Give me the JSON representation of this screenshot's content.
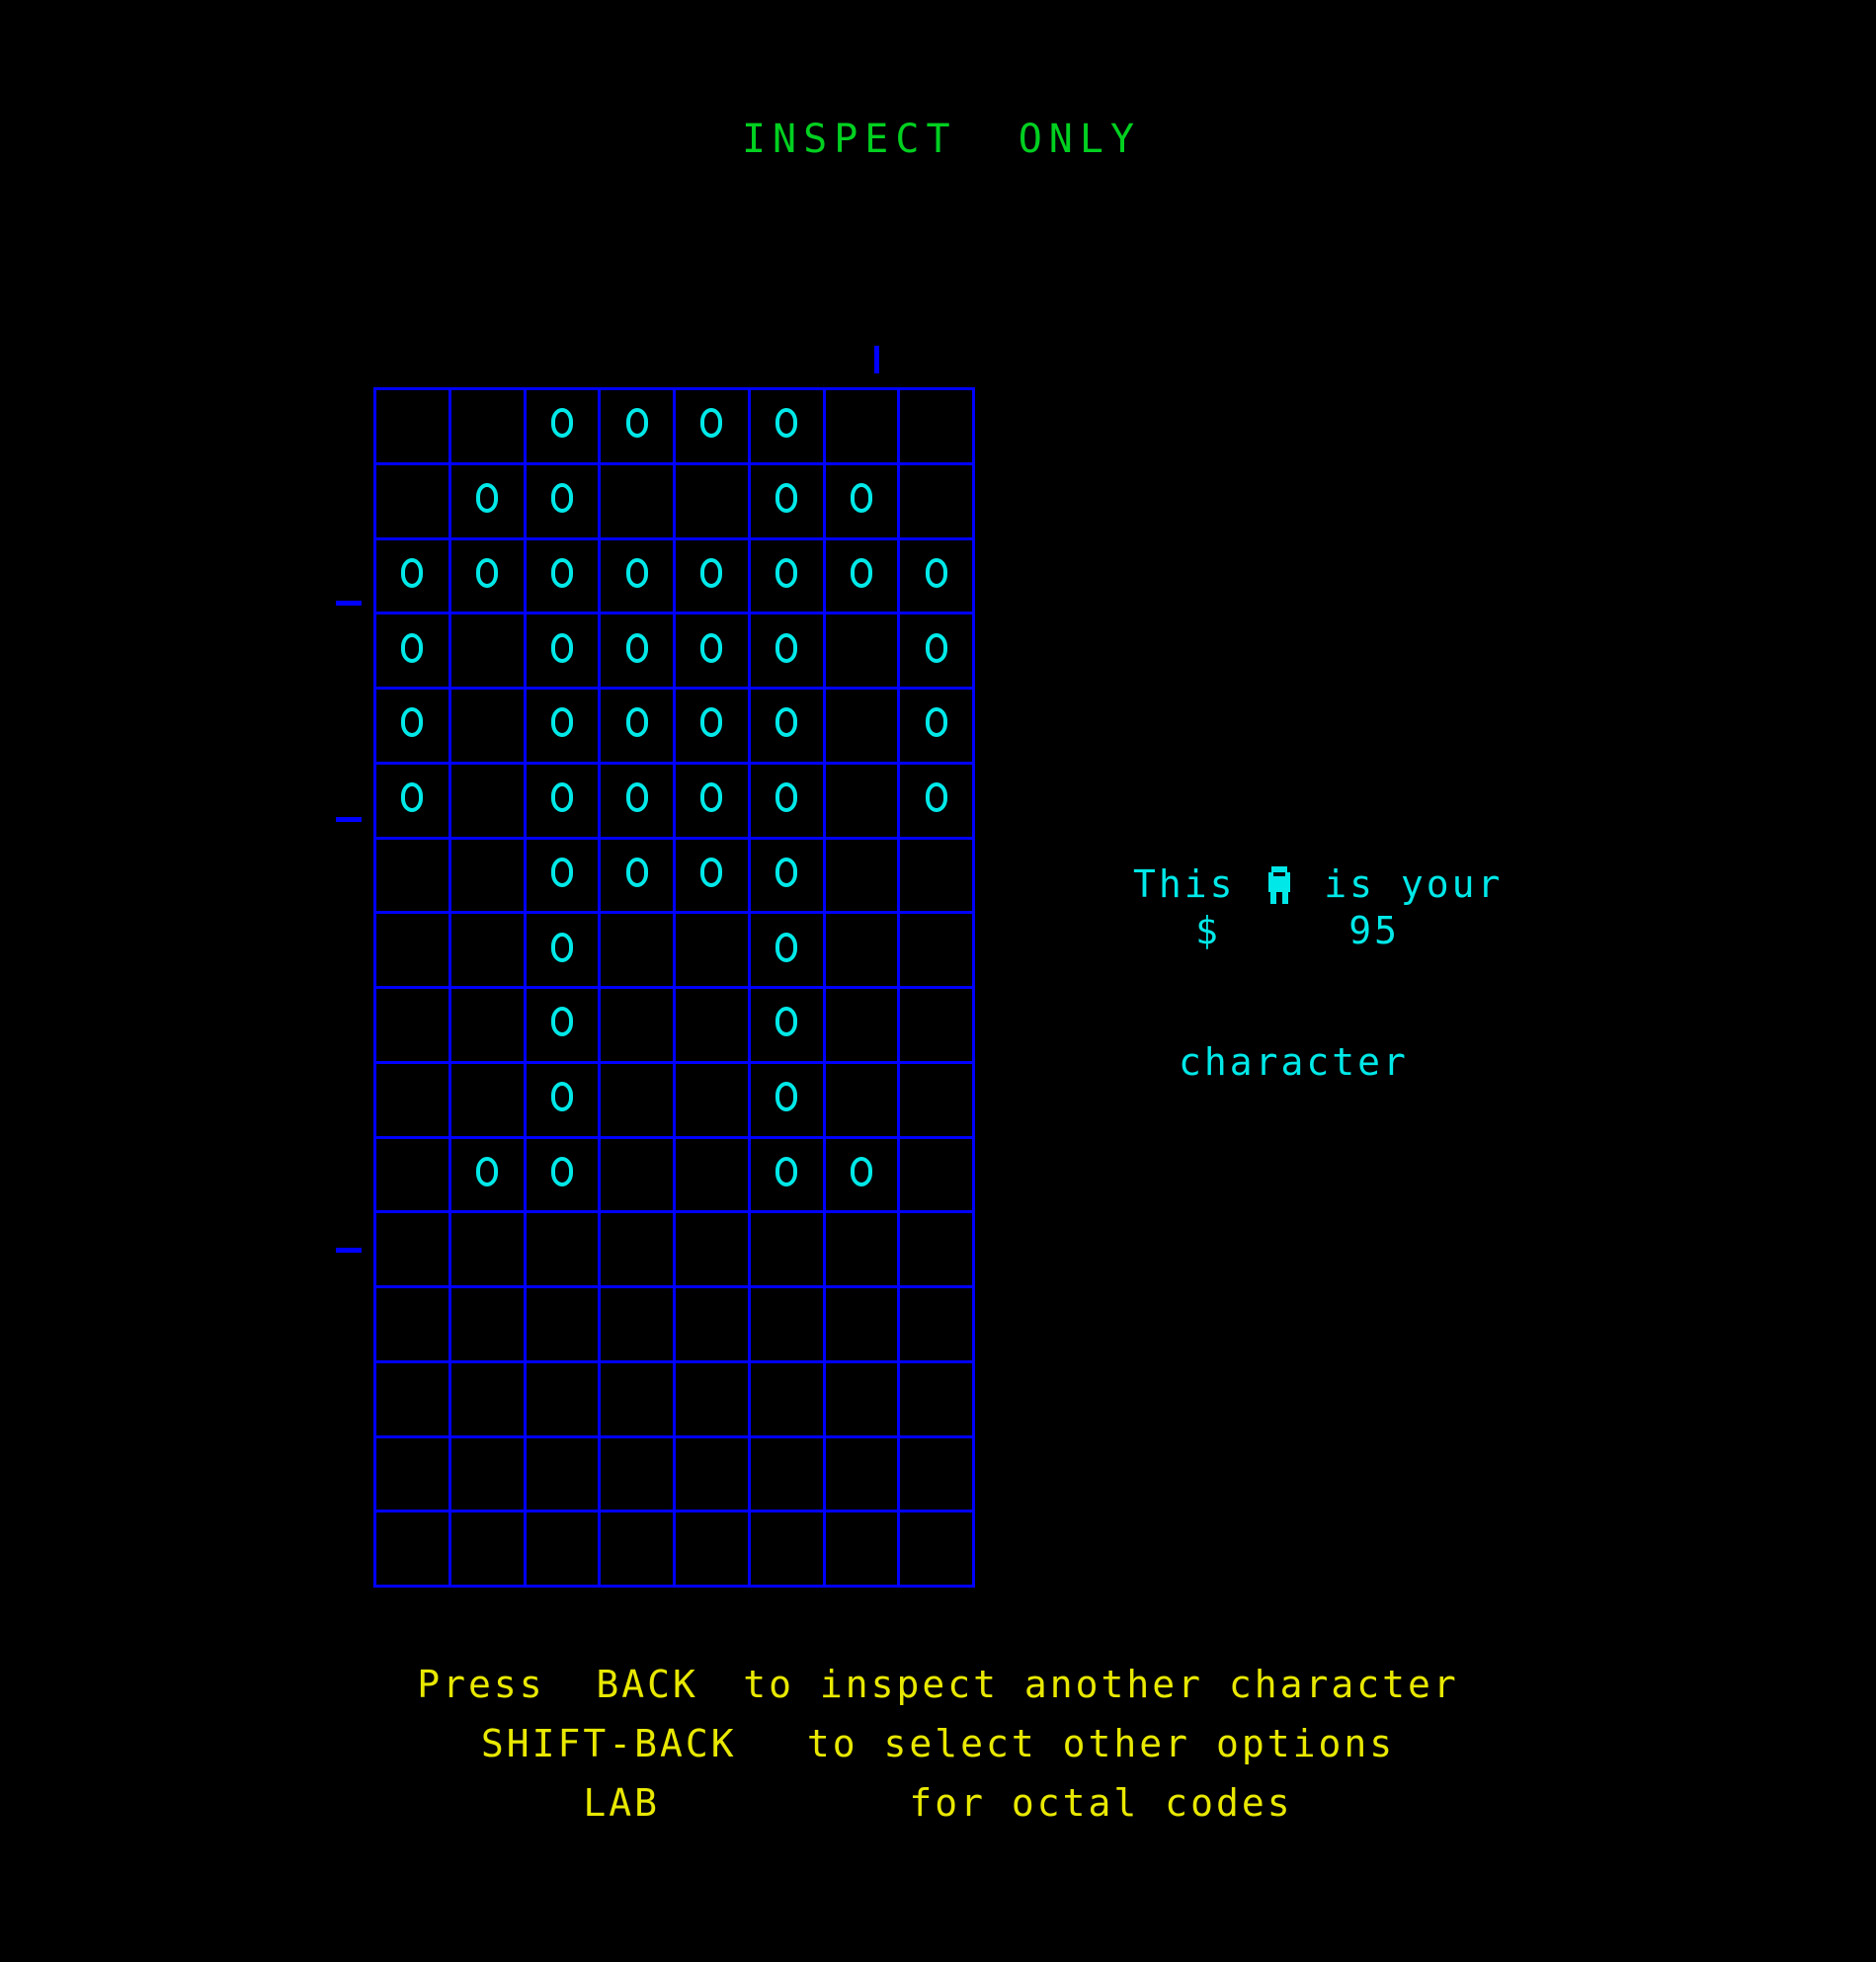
{
  "screen": {
    "background": "#000000",
    "title": "INSPECT  ONLY",
    "title_color": "#00d020"
  },
  "map": {
    "color_grid_lines": "#0000ff",
    "color_marks": "#00e8e8",
    "mark_glyph": "O",
    "rows": 16,
    "cols": 8,
    "cells": [
      [
        0,
        0,
        1,
        1,
        1,
        1,
        0,
        0
      ],
      [
        0,
        1,
        1,
        0,
        0,
        1,
        1,
        0
      ],
      [
        1,
        1,
        1,
        1,
        1,
        1,
        1,
        1
      ],
      [
        1,
        0,
        1,
        1,
        1,
        1,
        0,
        1
      ],
      [
        1,
        0,
        1,
        1,
        1,
        1,
        0,
        1
      ],
      [
        1,
        0,
        1,
        1,
        1,
        1,
        0,
        1
      ],
      [
        0,
        0,
        1,
        1,
        1,
        1,
        0,
        0
      ],
      [
        0,
        0,
        1,
        0,
        0,
        1,
        0,
        0
      ],
      [
        0,
        0,
        1,
        0,
        0,
        1,
        0,
        0
      ],
      [
        0,
        0,
        1,
        0,
        0,
        1,
        0,
        0
      ],
      [
        0,
        1,
        1,
        0,
        0,
        1,
        1,
        0
      ],
      [
        0,
        0,
        0,
        0,
        0,
        0,
        0,
        0
      ],
      [
        0,
        0,
        0,
        0,
        0,
        0,
        0,
        0
      ],
      [
        0,
        0,
        0,
        0,
        0,
        0,
        0,
        0
      ],
      [
        0,
        0,
        0,
        0,
        0,
        0,
        0,
        0
      ],
      [
        0,
        0,
        0,
        0,
        0,
        0,
        0,
        0
      ]
    ],
    "ticks_left_rows": [
      3,
      6,
      12
    ],
    "tick_top_col": 7
  },
  "info": {
    "line1_before": "This ",
    "figure_icon": "character-figure-icon",
    "line1_after": " is your",
    "line2": "character",
    "color": "#00e8e8"
  },
  "money": {
    "symbol": "$",
    "amount": "95",
    "display": "$     95",
    "color": "#00e8e8"
  },
  "footer": {
    "color": "#e8e800",
    "lines": [
      {
        "key": "Press  BACK",
        "text": "to inspect another character"
      },
      {
        "key": "SHIFT-BACK",
        "text": "to select other options"
      },
      {
        "key": "LAB",
        "text": "for octal codes"
      }
    ]
  }
}
